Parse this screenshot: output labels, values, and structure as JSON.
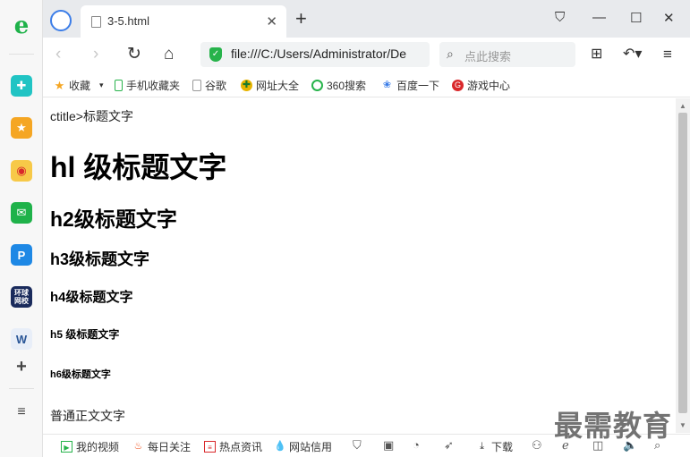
{
  "tab": {
    "title": "3-5.html"
  },
  "address": {
    "url": "file:///C:/Users/Administrator/De"
  },
  "search": {
    "placeholder": "点此搜索"
  },
  "bookmarks": [
    {
      "label": "收藏",
      "icon": "star-icon",
      "color": "#f5a623"
    },
    {
      "label": "手机收藏夹",
      "icon": "phone-icon",
      "color": "#27b34b"
    },
    {
      "label": "谷歌",
      "icon": "page-icon",
      "color": "#888888"
    },
    {
      "label": "网址大全",
      "icon": "globe-icon",
      "color": "#e8b400"
    },
    {
      "label": "360搜索",
      "icon": "360-search-icon",
      "color": "#27b34b"
    },
    {
      "label": "百度一下",
      "icon": "baidu-paw-icon",
      "color": "#3b7de8"
    },
    {
      "label": "游戏中心",
      "icon": "game-icon",
      "color": "#d9282b"
    }
  ],
  "page": {
    "title_line": "ctitle>标题文字",
    "h1": "hl 级标题文字",
    "h2": "h2级标题文字",
    "h3": "h3级标题文字",
    "h4": "h4级标题文字",
    "h5": "h5 级标题文字",
    "h6": "h6级标题文字",
    "p": "普通正文文字"
  },
  "statusbar": {
    "my_video": "我的视频",
    "daily_focus": "每日关注",
    "hot_news": "热点资讯",
    "site_trust": "网站信用",
    "download": "下载"
  },
  "sidebar_app": {
    "ie_label": "e",
    "news_label": "环球\n网校"
  },
  "watermark": "最需教育",
  "colors": {
    "accent": "#3b7de8",
    "green": "#27b34b",
    "orange": "#f5a623"
  }
}
